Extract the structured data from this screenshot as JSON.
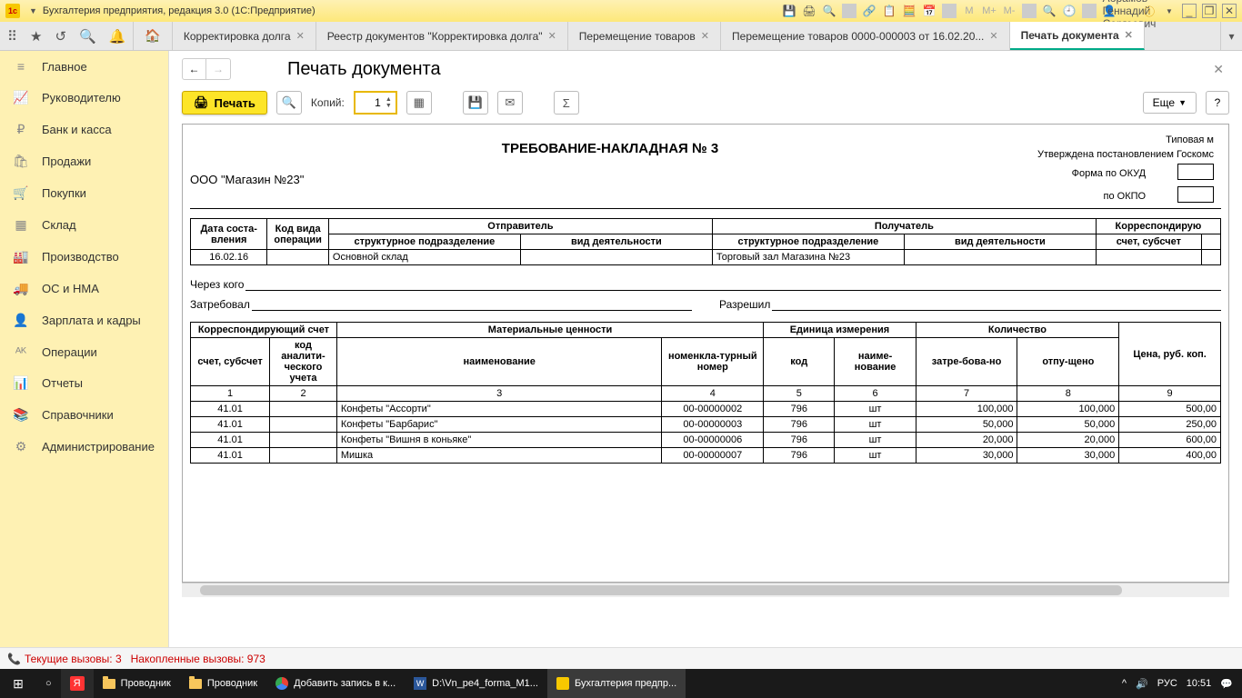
{
  "titlebar": {
    "app_title": "Бухгалтерия предприятия, редакция 3.0  (1С:Предприятие)",
    "user": "Абрамов Геннадий Сергеевич",
    "m_labels": [
      "M",
      "M+",
      "M-"
    ]
  },
  "tabs": [
    {
      "label": "Корректировка долга",
      "active": false
    },
    {
      "label": "Реестр документов \"Корректировка долга\"",
      "active": false
    },
    {
      "label": "Перемещение товаров",
      "active": false
    },
    {
      "label": "Перемещение товаров 0000-000003 от 16.02.20...",
      "active": false
    },
    {
      "label": "Печать документа",
      "active": true
    }
  ],
  "sidebar": {
    "items": [
      {
        "icon": "≡",
        "label": "Главное"
      },
      {
        "icon": "📈",
        "label": "Руководителю"
      },
      {
        "icon": "₽",
        "label": "Банк и касса"
      },
      {
        "icon": "🛍",
        "label": "Продажи"
      },
      {
        "icon": "🛒",
        "label": "Покупки"
      },
      {
        "icon": "▦",
        "label": "Склад"
      },
      {
        "icon": "🏭",
        "label": "Производство"
      },
      {
        "icon": "🚚",
        "label": "ОС и НМА"
      },
      {
        "icon": "👤",
        "label": "Зарплата и кадры"
      },
      {
        "icon": "ᴬᴷ",
        "label": "Операции"
      },
      {
        "icon": "📊",
        "label": "Отчеты"
      },
      {
        "icon": "📚",
        "label": "Справочники"
      },
      {
        "icon": "⚙",
        "label": "Администрирование"
      }
    ]
  },
  "page": {
    "title": "Печать документа",
    "toolbar": {
      "print_label": "Печать",
      "copies_label": "Копий:",
      "copies_value": "1",
      "more_label": "Еще",
      "help_label": "?"
    }
  },
  "document": {
    "right_header1": "Типовая м",
    "right_header2": "Утверждена постановлением Госкомс",
    "title": "ТРЕБОВАНИЕ-НАКЛАДНАЯ № 3",
    "org": "ООО \"Магазин №23\"",
    "form_okud": "Форма по ОКУД",
    "form_okpo": "по ОКПО",
    "header_table": {
      "cols": [
        "Дата соста-вления",
        "Код вида операции",
        "Отправитель",
        "Получатель",
        "Корреспондирую"
      ],
      "sub_sender": [
        "структурное подразделение",
        "вид деятельности"
      ],
      "sub_receiver": [
        "структурное подразделение",
        "вид деятельности"
      ],
      "acct": "счет, субсчет",
      "row": {
        "date": "16.02.16",
        "op": "",
        "sender_unit": "Основной склад",
        "sender_act": "",
        "receiver_unit": "Торговый зал Магазина №23",
        "receiver_act": "",
        "acct": ""
      }
    },
    "sig": {
      "through": "Через кого",
      "requested": "Затребовал",
      "approved": "Разрешил"
    },
    "items_table": {
      "h1": [
        "Корреспондирующий счет",
        "Материальные ценности",
        "Единица измерения",
        "Количество",
        "Цена, руб. коп."
      ],
      "h2": [
        "счет, субсчет",
        "код аналити-ческого учета",
        "наименование",
        "номенкла-турный номер",
        "код",
        "наиме-нование",
        "затре-бова-но",
        "отпу-щено",
        ""
      ],
      "nums": [
        "1",
        "2",
        "3",
        "4",
        "5",
        "6",
        "7",
        "8",
        "9"
      ],
      "rows": [
        {
          "acct": "41.01",
          "code": "",
          "name": "Конфеты \"Ассорти\"",
          "nom": "00-00000002",
          "unit_code": "796",
          "unit_name": "шт",
          "req": "100,000",
          "rel": "100,000",
          "price": "500,00"
        },
        {
          "acct": "41.01",
          "code": "",
          "name": "Конфеты \"Барбарис\"",
          "nom": "00-00000003",
          "unit_code": "796",
          "unit_name": "шт",
          "req": "50,000",
          "rel": "50,000",
          "price": "250,00"
        },
        {
          "acct": "41.01",
          "code": "",
          "name": "Конфеты \"Вишня в коньяке\"",
          "nom": "00-00000006",
          "unit_code": "796",
          "unit_name": "шт",
          "req": "20,000",
          "rel": "20,000",
          "price": "600,00"
        },
        {
          "acct": "41.01",
          "code": "",
          "name": "Мишка",
          "nom": "00-00000007",
          "unit_code": "796",
          "unit_name": "шт",
          "req": "30,000",
          "rel": "30,000",
          "price": "400,00"
        }
      ]
    }
  },
  "statusbar": {
    "current": "Текущие вызовы:  3",
    "accum": "Накопленные вызовы:  973"
  },
  "taskbar": {
    "items": [
      {
        "icon": "folder",
        "label": "Проводник"
      },
      {
        "icon": "folder",
        "label": "Проводник"
      },
      {
        "icon": "chrome",
        "label": "Добавить запись в к..."
      },
      {
        "icon": "word",
        "label": "D:\\Vn_pe4_forma_M1..."
      },
      {
        "icon": "1c",
        "label": "Бухгалтерия предпр...",
        "active": true
      }
    ],
    "lang": "РУС",
    "time": "10:51"
  }
}
